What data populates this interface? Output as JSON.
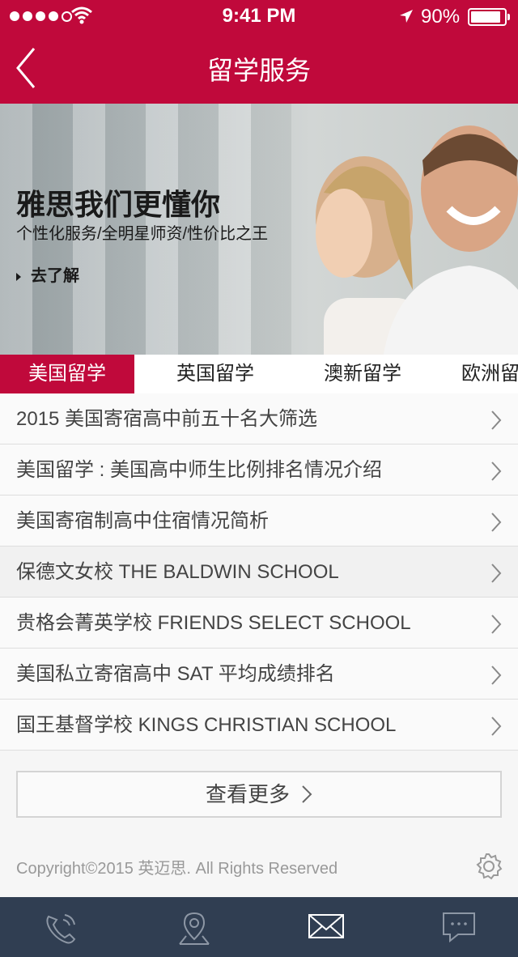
{
  "status_bar": {
    "time": "9:41 PM",
    "battery": "90%"
  },
  "nav": {
    "title": "留学服务",
    "back_icon": "chevron-left-icon"
  },
  "banner": {
    "title": "雅思我们更懂你",
    "subtitle": "个性化服务/全明星师资/性价比之王",
    "link": "去了解"
  },
  "tabs": [
    {
      "label": "美国留学",
      "active": true
    },
    {
      "label": "英国留学",
      "active": false
    },
    {
      "label": "澳新留学",
      "active": false
    },
    {
      "label": "欧洲留",
      "active": false
    }
  ],
  "articles": [
    "2015 美国寄宿高中前五十名大筛选",
    "美国留学 : 美国高中师生比例排名情况介绍",
    "美国寄宿制高中住宿情况简析",
    "保德文女校 THE BALDWIN SCHOOL",
    "贵格会菁英学校 FRIENDS SELECT SCHOOL",
    "美国私立寄宿高中 SAT 平均成绩排名",
    "国王基督学校 KINGS CHRISTIAN SCHOOL"
  ],
  "more_button": "查看更多",
  "copyright": "Copyright©2015 英迈思. All Rights Reserved",
  "footer_icons": [
    "phone-icon",
    "location-icon",
    "mail-icon",
    "chat-icon"
  ],
  "colors": {
    "brand": "#c0093b",
    "footer": "#303e52"
  }
}
